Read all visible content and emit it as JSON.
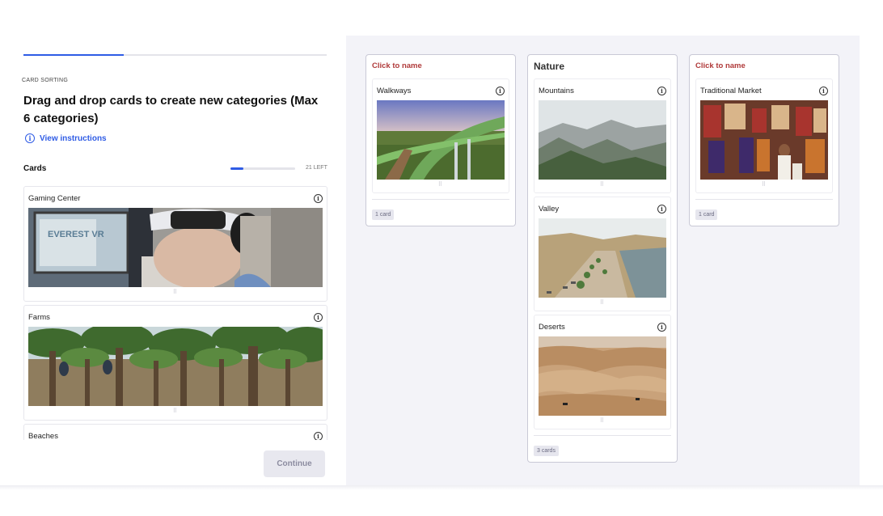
{
  "progress": {
    "fraction": 0.33
  },
  "task": {
    "section_tag": "CARD SORTING",
    "headline": "Drag and drop cards to create new categories (Max 6 categories)",
    "instructions_label": "View instructions"
  },
  "cards_panel": {
    "label": "Cards",
    "progress_fraction": 0.2,
    "remaining": "21 LEFT",
    "items": [
      {
        "title": "Gaming Center",
        "image": "vr-headset-photo"
      },
      {
        "title": "Farms",
        "image": "date-palm-farm-photo"
      },
      {
        "title": "Beaches",
        "image": "beach-photo"
      }
    ]
  },
  "continue_label": "Continue",
  "categories": [
    {
      "title": "Click to name",
      "named": false,
      "cards": [
        {
          "title": "Walkways",
          "image": "green-walkway-photo"
        }
      ],
      "count_label": "1 card"
    },
    {
      "title": "Nature",
      "named": true,
      "cards": [
        {
          "title": "Mountains",
          "image": "mountain-ridge-photo"
        },
        {
          "title": "Valley",
          "image": "valley-road-photo"
        },
        {
          "title": "Deserts",
          "image": "sand-dunes-photo"
        }
      ],
      "count_label": "3 cards"
    },
    {
      "title": "Click to name",
      "named": false,
      "cards": [
        {
          "title": "Traditional Market",
          "image": "souk-market-photo"
        }
      ],
      "count_label": "1 card"
    }
  ],
  "colors": {
    "accent": "#2f5ce5",
    "unnamed_title": "#b03a3a",
    "panel_bg": "#f3f3f8"
  }
}
